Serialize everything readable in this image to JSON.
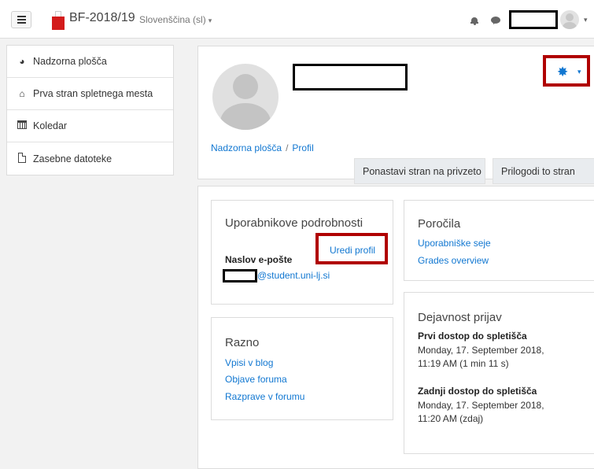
{
  "navbar": {
    "site_name": "BF-2018/19",
    "language": "Slovenščina (sl)",
    "language_caret": "▾",
    "icons": [
      "menu-icon",
      "bell-icon",
      "chat-icon",
      "avatar"
    ]
  },
  "drawer": {
    "items": [
      {
        "label": "Nadzorna plošča",
        "icon": "dashboard-icon"
      },
      {
        "label": "Prva stran spletnega mesta",
        "icon": "home-icon"
      },
      {
        "label": "Koledar",
        "icon": "calendar-icon"
      },
      {
        "label": "Zasebne datoteke",
        "icon": "file-icon"
      }
    ]
  },
  "header": {
    "breadcrumb": [
      "Nadzorna plošča",
      "Profil"
    ],
    "breadcrumb_sep": "/",
    "buttons": {
      "reset": "Ponastavi stran na privzeto",
      "customize": "Prilogodi to stran"
    }
  },
  "user_details": {
    "title": "Uporabnikove podrobnosti",
    "edit_profile": "Uredi profil",
    "email_label": "Naslov e-pošte",
    "email_domain": "@student.uni-lj.si"
  },
  "reports": {
    "title": "Poročila",
    "links": [
      "Uporabniške seje",
      "Grades overview"
    ]
  },
  "misc": {
    "title": "Razno",
    "links": [
      "Vpisi v blog",
      "Objave foruma",
      "Razprave v forumu"
    ]
  },
  "login_activity": {
    "title": "Dejavnost prijav",
    "first_label": "Prvi dostop do spletišča",
    "first_date": "Monday, 17. September 2018,",
    "first_time": "11:19 AM  (1 min 11 s)",
    "last_label": "Zadnji dostop do spletišča",
    "last_date": "Monday, 17. September 2018,",
    "last_time": "11:20 AM  (zdaj)"
  },
  "colors": {
    "link": "#1177d1",
    "highlight_box": "#b00000",
    "logo": "#d31b1b"
  }
}
